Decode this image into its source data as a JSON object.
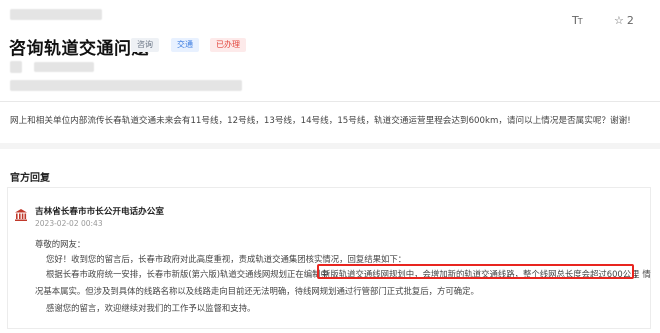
{
  "header": {
    "font_size_icon": "TT",
    "star_count": "2"
  },
  "page": {
    "title": "咨询轨道交通问题",
    "tags": [
      "咨询",
      "交通",
      "已办理"
    ]
  },
  "question": {
    "text": "网上和相关单位内部流传长春轨道交通未来会有11号线，12号线，13号线，14号线，15号线，轨道交通运营里程会达到600km，请问以上情况是否属实呢？谢谢!"
  },
  "reply": {
    "section_title": "官方回复",
    "office": "吉林省长春市市长公开电话办公室",
    "date": "2023-02-02 00:43",
    "greeting": "尊敬的网友：",
    "line1": "您好！收到您的留言后，长春市政府对此高度重视，责成轨道交通集团核实情况，回复结果如下：",
    "line2_prefix": "根据长春市政府统一安排，长春市新版(第六版)轨道交通线网规划正在编制中",
    "line2_highlight": "新版轨道交通线网规划中，会增加新的轨道交通线路，整个线网总长度会超过600公里",
    "line2_suffix": "，情",
    "line3": "况基本属实。但涉及到具体的线路名称以及线路走向目前还无法明确，待线网规划通过行管部门正式批复后，方可确定。",
    "line4": "感谢您的留言，欢迎继续对我们的工作予以监督和支持。"
  },
  "colors": {
    "highlight_border": "#e8251f",
    "tag_red": "#e2453c",
    "tag_blue": "#3a7be0"
  }
}
